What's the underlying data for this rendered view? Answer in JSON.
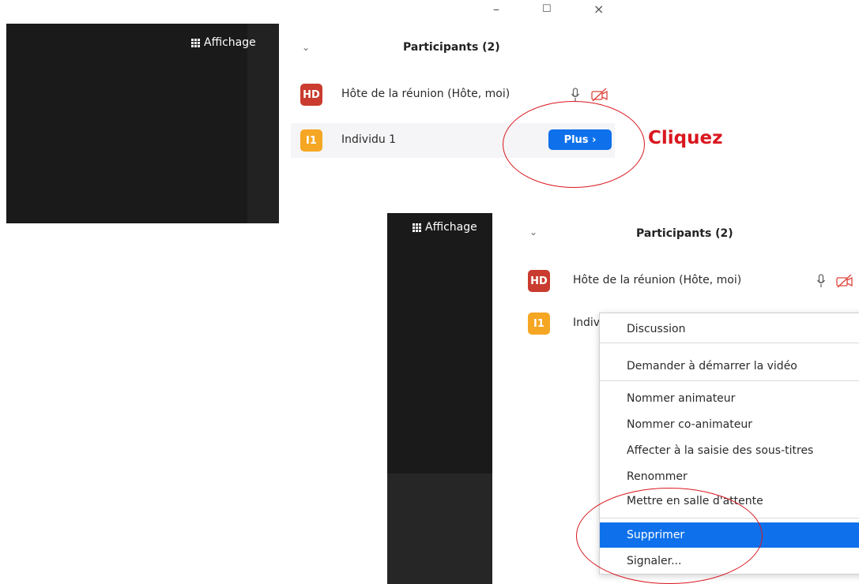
{
  "window_controls": {
    "minimize": "–",
    "maximize": "☐",
    "close": "×"
  },
  "top_view": {
    "view_button_label": "Affichage",
    "panel_title": "Participants (2)",
    "participants": [
      {
        "initials": "HD",
        "name": "Hôte de la réunion (Hôte, moi)",
        "avatar_color": "#c93c2f"
      },
      {
        "initials": "I1",
        "name": "Individu 1",
        "avatar_color": "#f5a623"
      }
    ],
    "more_button_label": "Plus ›"
  },
  "annotation": {
    "text": "Cliquez",
    "color": "#d9171f"
  },
  "bottom_view": {
    "view_button_label": "Affichage",
    "panel_title": "Participants (2)",
    "participants": [
      {
        "initials": "HD",
        "name": "Hôte de la réunion (Hôte, moi)"
      },
      {
        "initials": "I1",
        "name": "Indiv"
      }
    ],
    "menu_items": [
      "Discussion",
      "Demander à démarrer la vidéo",
      "Nommer animateur",
      "Nommer co-animateur",
      "Affecter à la saisie des sous-titres",
      "Renommer",
      "Mettre en salle d'attente",
      "Supprimer",
      "Signaler..."
    ],
    "selected_item": "Supprimer"
  },
  "colors": {
    "accent": "#0e71eb",
    "muted_red": "#e0443b",
    "annotation_red": "#d9171f"
  }
}
